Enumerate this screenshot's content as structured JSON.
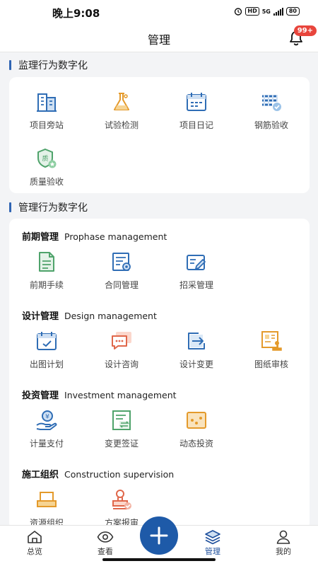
{
  "status_bar": {
    "time": "晚上9:08",
    "hd_badge": "HD",
    "network": "5G",
    "battery": "80"
  },
  "header": {
    "title": "管理",
    "notification_count": "99+"
  },
  "sections": [
    {
      "title": "监理行为数字化"
    },
    {
      "title": "管理行为数字化"
    }
  ],
  "supervision_items": [
    {
      "label": "项目旁站",
      "icon": "building-icon"
    },
    {
      "label": "试验检测",
      "icon": "flask-icon"
    },
    {
      "label": "项目日记",
      "icon": "calendar-icon"
    },
    {
      "label": "钢筋验收",
      "icon": "rebar-check-icon"
    },
    {
      "label": "质量验收",
      "icon": "quality-shield-icon"
    }
  ],
  "groups": [
    {
      "title_cn": "前期管理",
      "title_en": "Prophase management",
      "items": [
        {
          "label": "前期手续"
        },
        {
          "label": "合同管理"
        },
        {
          "label": "招采管理"
        }
      ]
    },
    {
      "title_cn": "设计管理",
      "title_en": "Design management",
      "items": [
        {
          "label": "出图计划"
        },
        {
          "label": "设计咨询"
        },
        {
          "label": "设计变更"
        },
        {
          "label": "图纸审核"
        }
      ]
    },
    {
      "title_cn": "投资管理",
      "title_en": "Investment management",
      "items": [
        {
          "label": "计量支付"
        },
        {
          "label": "变更签证"
        },
        {
          "label": "动态投资"
        }
      ]
    },
    {
      "title_cn": "施工组织",
      "title_en": "Construction supervision",
      "items": [
        {
          "label": "资源组织"
        },
        {
          "label": "方案报审"
        }
      ]
    }
  ],
  "tabs": [
    {
      "label": "总览"
    },
    {
      "label": "查看"
    },
    {
      "label": "管理"
    },
    {
      "label": "我的"
    }
  ],
  "colors": {
    "primary": "#1e5aa8",
    "icon_blue": "#2f6db5",
    "icon_orange": "#e49a2b",
    "icon_green": "#4fa36b",
    "badge_red": "#e8453c"
  }
}
